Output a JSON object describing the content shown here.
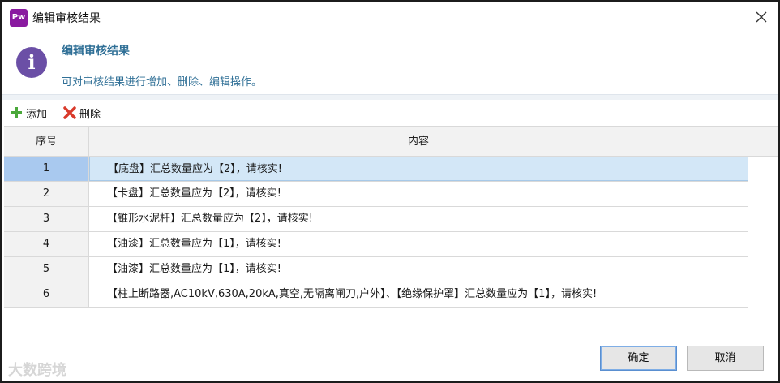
{
  "window": {
    "app_logo_text": "Pw",
    "title": "编辑审核结果"
  },
  "info": {
    "icon_name": "info-icon",
    "title": "编辑审核结果",
    "description": "可对审核结果进行增加、删除、编辑操作。"
  },
  "toolbar": {
    "add_label": "添加",
    "delete_label": "删除"
  },
  "grid": {
    "columns": [
      "序号",
      "内容"
    ],
    "rows": [
      {
        "seq": "1",
        "content": "【底盘】汇总数量应为【2】，请核实!"
      },
      {
        "seq": "2",
        "content": "【卡盘】汇总数量应为【2】，请核实!"
      },
      {
        "seq": "3",
        "content": "【锥形水泥杆】汇总数量应为【2】，请核实!"
      },
      {
        "seq": "4",
        "content": "【油漆】汇总数量应为【1】，请核实!"
      },
      {
        "seq": "5",
        "content": "【油漆】汇总数量应为【1】，请核实!"
      },
      {
        "seq": "6",
        "content": "【柱上断路器,AC10kV,630A,20kA,真空,无隔离闸刀,户外】、【绝缘保护罩】汇总数量应为【1】，请核实!"
      }
    ],
    "selected_row": 0
  },
  "buttons": {
    "ok_label": "确定",
    "cancel_label": "取消"
  },
  "watermark": "大数跨境",
  "colors": {
    "accent_text": "#2f6f96",
    "info_icon": "#6b4fa6",
    "selection": "#d3e7f7",
    "logo": "#8a1aa0"
  }
}
